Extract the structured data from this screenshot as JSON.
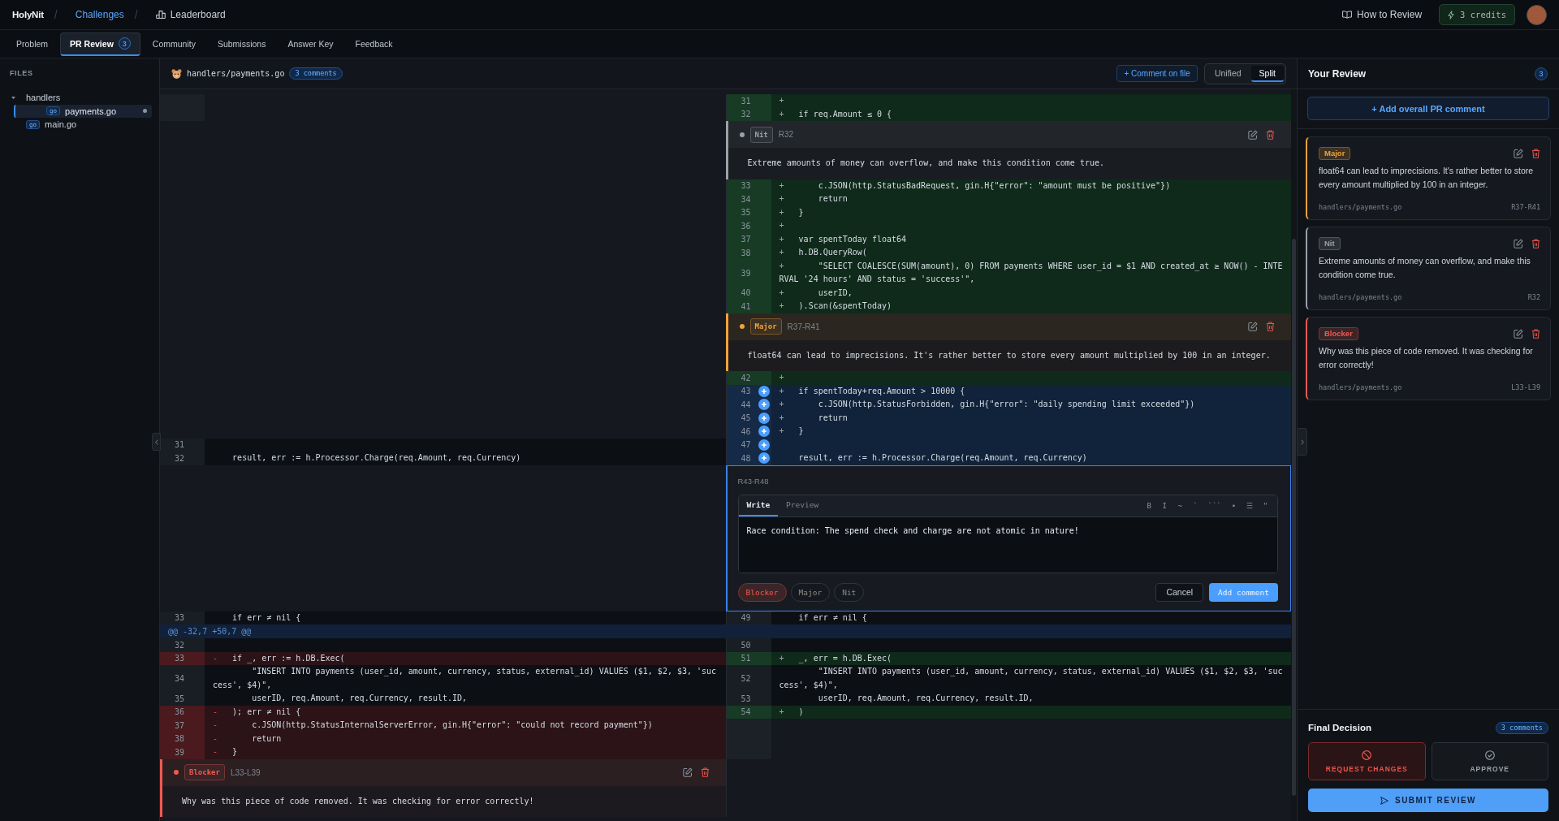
{
  "topbar": {
    "brand": "HolyNit",
    "breadcrumbs": [
      {
        "separator": "/",
        "label": "Challenges",
        "kind": "link"
      },
      {
        "separator": "/",
        "label": "Leaderboard",
        "kind": "section"
      }
    ],
    "help": "How to Review",
    "credits": "3 credits"
  },
  "tabs": [
    {
      "label": "Problem",
      "selected": false
    },
    {
      "label": "PR Review",
      "selected": true,
      "count": "3"
    },
    {
      "label": "Community",
      "selected": false
    },
    {
      "label": "Submissions",
      "selected": false
    },
    {
      "label": "Answer Key",
      "selected": false
    },
    {
      "label": "Feedback",
      "selected": false
    }
  ],
  "files": {
    "title": "FILES",
    "tree": [
      {
        "name": "handlers",
        "kind": "folder",
        "expanded": true,
        "selected": false,
        "children": [
          {
            "name": "payments.go",
            "kind": "file",
            "tag": "go",
            "selected": true,
            "modified": true
          }
        ]
      },
      {
        "name": "main.go",
        "kind": "file",
        "tag": "go",
        "selected": false,
        "modified": false
      }
    ]
  },
  "diff": {
    "file": {
      "name": "handlers/payments.go",
      "comments": "3 comments"
    },
    "comment_button": "+ Comment on file",
    "views": [
      {
        "label": "Unified",
        "selected": false
      },
      {
        "label": "Split",
        "selected": true
      }
    ],
    "rows": [
      {
        "kind": "pair",
        "left": {
          "kind": "blank"
        },
        "right": {
          "kind": "added",
          "number": "31",
          "sign": "+",
          "selected": false
        }
      },
      {
        "kind": "pair",
        "left": {
          "kind": "blank"
        },
        "right": {
          "kind": "added",
          "number": "32",
          "sign": "+",
          "code": "\tif req.Amount ≤ 0 {",
          "selected": false
        }
      },
      {
        "kind": "pair",
        "right": {
          "kind": "comment",
          "color": "#9aa1a9",
          "label": "Nit",
          "range": "R32",
          "text": "Extreme amounts of money can overflow, and make this condition come true."
        }
      },
      {
        "kind": "pair",
        "right": {
          "kind": "added",
          "number": "33",
          "sign": "+",
          "code": "\t\tc.JSON(http.StatusBadRequest, gin.H{\"error\": \"amount must be positive\"})",
          "selected": false
        }
      },
      {
        "kind": "pair",
        "right": {
          "kind": "added",
          "number": "34",
          "sign": "+",
          "code": "\t\treturn",
          "selected": false
        }
      },
      {
        "kind": "pair",
        "right": {
          "kind": "added",
          "number": "35",
          "sign": "+",
          "code": "\t}",
          "selected": false
        }
      },
      {
        "kind": "pair",
        "right": {
          "kind": "added",
          "number": "36",
          "sign": "+",
          "selected": false
        }
      },
      {
        "kind": "pair",
        "right": {
          "kind": "added",
          "number": "37",
          "sign": "+",
          "code": "\tvar spentToday float64",
          "selected": false
        }
      },
      {
        "kind": "pair",
        "right": {
          "kind": "added",
          "number": "38",
          "sign": "+",
          "code": "\th.DB.QueryRow(",
          "selected": false
        }
      },
      {
        "kind": "pair",
        "right": {
          "kind": "added",
          "number": "39",
          "sign": "+",
          "code": "\t\t\"SELECT COALESCE(SUM(amount), 0) FROM payments WHERE user_id = $1 AND created_at ≥ NOW() - INTERVAL '24 hours' AND status = 'success'\",",
          "selected": false
        }
      },
      {
        "kind": "pair",
        "right": {
          "kind": "added",
          "number": "40",
          "sign": "+",
          "code": "\t\tuserID,",
          "selected": false
        }
      },
      {
        "kind": "pair",
        "right": {
          "kind": "added",
          "number": "41",
          "sign": "+",
          "code": "\t).Scan(&spentToday)",
          "selected": false
        }
      },
      {
        "kind": "pair",
        "right": {
          "kind": "comment",
          "color": "#f0a33a",
          "label": "Major",
          "range": "R37-R41",
          "text": "float64 can lead to imprecisions. It's rather better to store every amount multiplied by 100 in an integer."
        }
      },
      {
        "kind": "pair",
        "right": {
          "kind": "added",
          "number": "42",
          "sign": "+",
          "selected": false
        }
      },
      {
        "kind": "pair",
        "right": {
          "kind": "added",
          "number": "43",
          "sign": "+",
          "code": "\tif spentToday+req.Amount > 10000 {",
          "selected": true
        }
      },
      {
        "kind": "pair",
        "right": {
          "kind": "added",
          "number": "44",
          "sign": "+",
          "code": "\t\tc.JSON(http.StatusForbidden, gin.H{\"error\": \"daily spending limit exceeded\"})",
          "selected": true
        }
      },
      {
        "kind": "pair",
        "right": {
          "kind": "added",
          "number": "45",
          "sign": "+",
          "code": "\t\treturn",
          "selected": true
        }
      },
      {
        "kind": "pair",
        "right": {
          "kind": "added",
          "number": "46",
          "sign": "+",
          "code": "\t}",
          "selected": true
        }
      },
      {
        "kind": "pair",
        "left": {
          "kind": "context",
          "number": "31",
          "selected": false
        },
        "right": {
          "kind": "context",
          "number": "47",
          "selected": true
        }
      },
      {
        "kind": "pair",
        "left": {
          "kind": "context",
          "number": "32",
          "code": "\tresult, err := h.Processor.Charge(req.Amount, req.Currency)",
          "selected": false
        },
        "right": {
          "kind": "context",
          "number": "48",
          "code": "\tresult, err := h.Processor.Charge(req.Amount, req.Currency)",
          "selected": true
        }
      },
      {
        "kind": "pair",
        "right": {
          "kind": "editor",
          "range": "R43-R48",
          "tabs": [
            {
              "label": "Write",
              "selected": true
            },
            {
              "label": "Preview",
              "selected": false
            }
          ],
          "toolbar": [
            "B",
            "I",
            "~",
            "`",
            "```",
            "•",
            "☰",
            "\""
          ],
          "value": "Race condition: The spend check and charge are not atomic in nature!",
          "severities": [
            {
              "label": "Blocker",
              "kind": "blocker",
              "selected": true
            },
            {
              "label": "Major",
              "kind": "major",
              "selected": false
            },
            {
              "label": "Nit",
              "kind": "nit",
              "selected": false
            }
          ],
          "cancel": "Cancel",
          "submit": "Add comment"
        }
      },
      {
        "kind": "pair",
        "left": {
          "kind": "context",
          "number": "33",
          "code": "\tif err ≠ nil {",
          "selected": false
        },
        "right": {
          "kind": "context",
          "number": "49",
          "code": "\tif err ≠ nil {",
          "selected": false
        }
      },
      {
        "kind": "hunk",
        "text": "@@ -32,7 +50,7 @@"
      },
      {
        "kind": "pair",
        "left": {
          "kind": "context",
          "number": "32",
          "selected": false
        },
        "right": {
          "kind": "context",
          "number": "50",
          "selected": false
        }
      },
      {
        "kind": "pair",
        "left": {
          "kind": "removed",
          "number": "33",
          "sign": "-",
          "code": "\tif _, err := h.DB.Exec(",
          "selected": false
        },
        "right": {
          "kind": "added",
          "number": "51",
          "sign": "+",
          "code": "\t_, err = h.DB.Exec(",
          "selected": false
        }
      },
      {
        "kind": "pair",
        "left": {
          "kind": "context",
          "number": "34",
          "code": "\t\t\"INSERT INTO payments (user_id, amount, currency, status, external_id) VALUES ($1, $2, $3, 'success', $4)\",",
          "selected": false
        },
        "right": {
          "kind": "context",
          "number": "52",
          "code": "\t\t\"INSERT INTO payments (user_id, amount, currency, status, external_id) VALUES ($1, $2, $3, 'success', $4)\",",
          "selected": false
        }
      },
      {
        "kind": "pair",
        "left": {
          "kind": "context",
          "number": "35",
          "code": "\t\tuserID, req.Amount, req.Currency, result.ID,",
          "selected": false
        },
        "right": {
          "kind": "context",
          "number": "53",
          "code": "\t\tuserID, req.Amount, req.Currency, result.ID,",
          "selected": false
        }
      },
      {
        "kind": "pair",
        "left": {
          "kind": "removed",
          "number": "36",
          "sign": "-",
          "code": "\t); err ≠ nil {",
          "selected": false
        },
        "right": {
          "kind": "added",
          "number": "54",
          "sign": "+",
          "code": "\t)",
          "selected": false
        }
      },
      {
        "kind": "pair",
        "left": {
          "kind": "removed",
          "number": "37",
          "sign": "-",
          "code": "\t\tc.JSON(http.StatusInternalServerError, gin.H{\"error\": \"could not record payment\"})",
          "selected": false
        },
        "right": {
          "kind": "blank"
        }
      },
      {
        "kind": "pair",
        "left": {
          "kind": "removed",
          "number": "38",
          "sign": "-",
          "code": "\t\treturn",
          "selected": false
        },
        "right": {
          "kind": "blank"
        }
      },
      {
        "kind": "pair",
        "left": {
          "kind": "removed",
          "number": "39",
          "sign": "-",
          "code": "\t}",
          "selected": false
        },
        "right": {
          "kind": "blank"
        }
      },
      {
        "kind": "pair",
        "left": {
          "kind": "comment",
          "color": "#ef5a52",
          "label": "Blocker",
          "range": "L33-L39",
          "text": "Why was this piece of code removed. It was checking for error correctly!"
        }
      }
    ]
  },
  "review": {
    "title": "Your Review",
    "count": "3",
    "add_button": "+ Add overall PR comment",
    "comments": [
      {
        "kind": "major",
        "label": "Major",
        "text": "float64 can lead to imprecisions. It's rather better to store every amount multiplied by 100 in an integer.",
        "file": "handlers/payments.go",
        "range": "R37-R41"
      },
      {
        "kind": "nit",
        "label": "Nit",
        "text": "Extreme amounts of money can overflow, and make this condition come true.",
        "file": "handlers/payments.go",
        "range": "R32"
      },
      {
        "kind": "blocker",
        "label": "Blocker",
        "text": "Why was this piece of code removed. It was checking for error correctly!",
        "file": "handlers/payments.go",
        "range": "L33-L39"
      }
    ],
    "decision": {
      "title": "Final Decision",
      "count": "3 comments",
      "options": [
        {
          "kind": "request",
          "label": "REQUEST CHANGES",
          "selected": true
        },
        {
          "kind": "approve",
          "label": "APPROVE",
          "selected": false
        }
      ],
      "submit": "SUBMIT REVIEW"
    }
  }
}
